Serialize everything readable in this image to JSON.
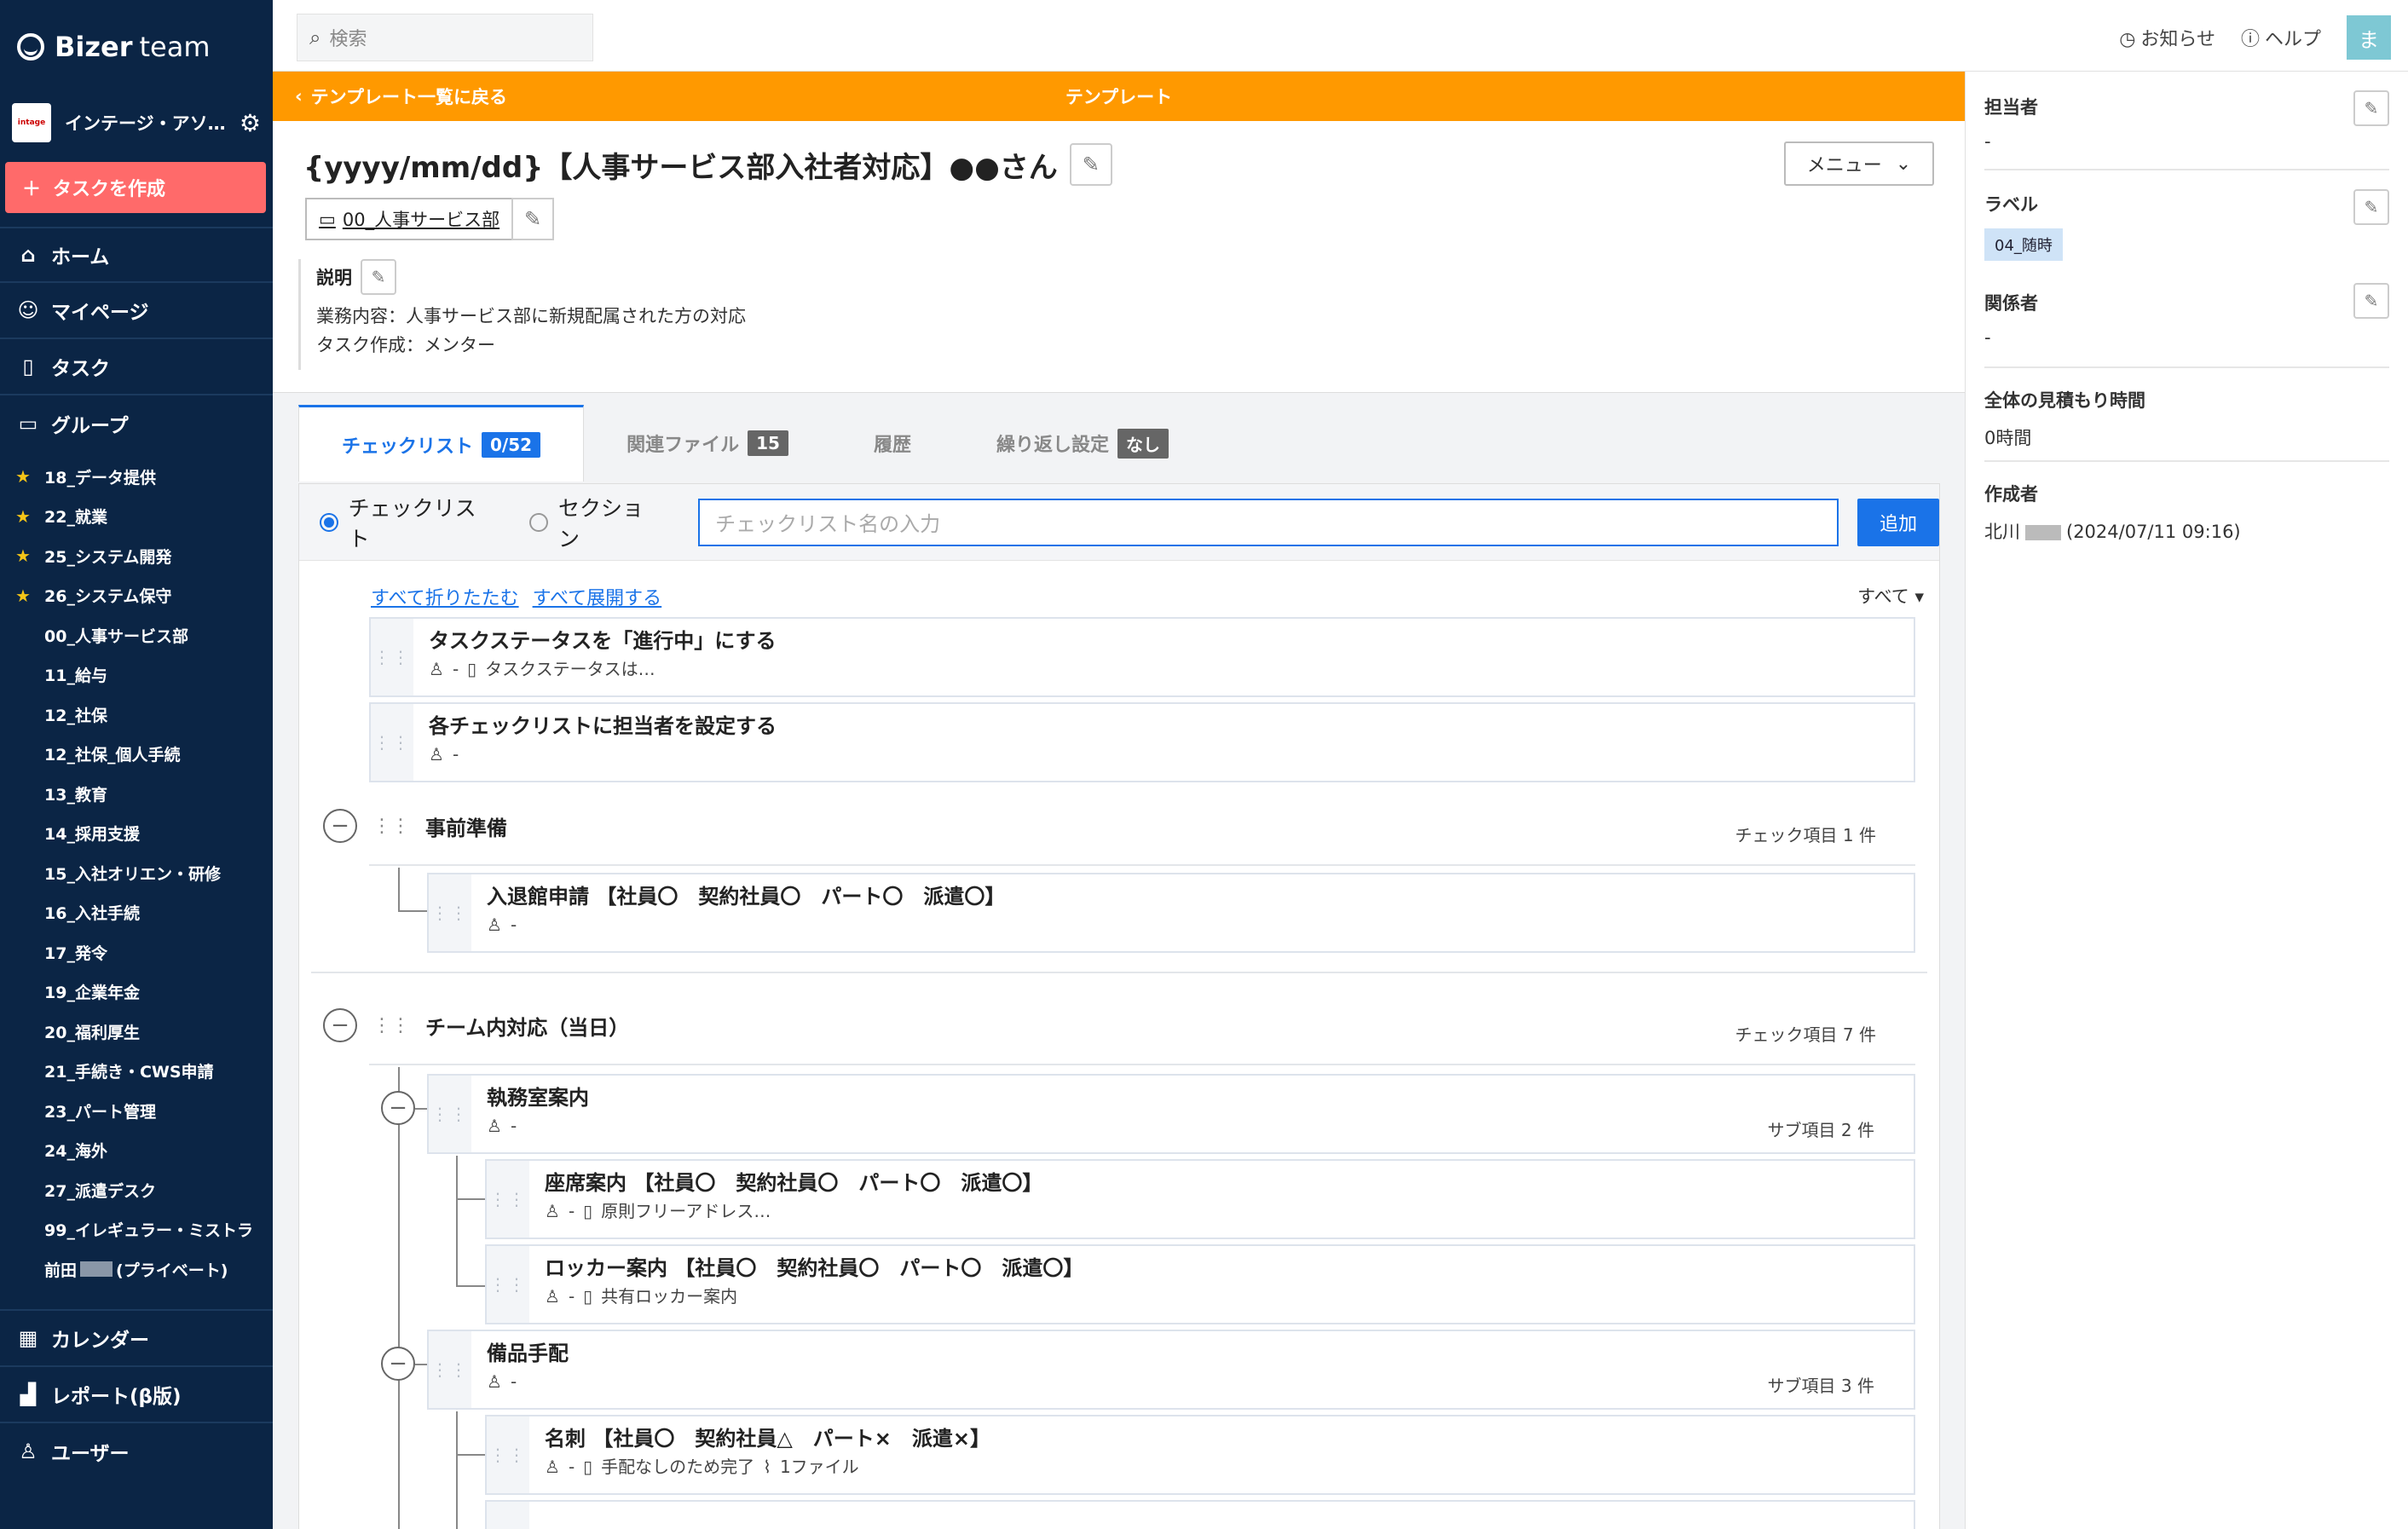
{
  "sidebar": {
    "brand": "Bizer",
    "brand_suffix": "team",
    "workspace": "インテージ・アソ…",
    "create_task": "タスクを作成",
    "nav": [
      "ホーム",
      "マイページ",
      "タスク",
      "グループ"
    ],
    "groups": [
      {
        "label": "18_データ提供",
        "star": true
      },
      {
        "label": "22_就業",
        "star": true
      },
      {
        "label": "25_システム開発",
        "star": true
      },
      {
        "label": "26_システム保守",
        "star": true
      },
      {
        "label": "00_人事サービス部",
        "star": false
      },
      {
        "label": "11_給与",
        "star": false
      },
      {
        "label": "12_社保",
        "star": false
      },
      {
        "label": "12_社保_個人手続",
        "star": false
      },
      {
        "label": "13_教育",
        "star": false
      },
      {
        "label": "14_採用支援",
        "star": false
      },
      {
        "label": "15_入社オリエン・研修",
        "star": false
      },
      {
        "label": "16_入社手続",
        "star": false
      },
      {
        "label": "17_発令",
        "star": false
      },
      {
        "label": "19_企業年金",
        "star": false
      },
      {
        "label": "20_福利厚生",
        "star": false
      },
      {
        "label": "21_手続き・CWS申請",
        "star": false
      },
      {
        "label": "23_パート管理",
        "star": false
      },
      {
        "label": "24_海外",
        "star": false
      },
      {
        "label": "27_派遣デスク",
        "star": false
      },
      {
        "label": "99_イレギュラー・ミストラ",
        "star": false
      }
    ],
    "private_group_prefix": "前田",
    "private_group_suffix": "(プライベート)",
    "bottom_nav": [
      "カレンダー",
      "レポート(β版)",
      "ユーザー"
    ]
  },
  "topbar": {
    "search_placeholder": "検索",
    "notice": "お知らせ",
    "help": "ヘルプ",
    "avatar": "ま"
  },
  "banner": {
    "back": "テンプレート一覧に戻る",
    "center": "テンプレート"
  },
  "task": {
    "title": "{yyyy/mm/dd}【人事サービス部入社者対応】●●さん",
    "menu": "メニュー",
    "folder": "00_人事サービス部",
    "desc_label": "説明",
    "desc_lines": [
      "業務内容：人事サービス部に新規配属された方の対応",
      "タスク作成：メンター"
    ]
  },
  "tabs": [
    {
      "label": "チェックリスト",
      "badge": "0/52"
    },
    {
      "label": "関連ファイル",
      "badge": "15"
    },
    {
      "label": "履歴",
      "badge": ""
    },
    {
      "label": "繰り返し設定",
      "badge": "なし"
    }
  ],
  "checklist": {
    "radio_checklist": "チェックリスト",
    "radio_section": "セクション",
    "input_placeholder": "チェックリスト名の入力",
    "add": "追加",
    "collapse_all": "すべて折りたたむ",
    "expand_all": "すべて展開する",
    "filter": "すべて",
    "items": [
      {
        "title": "タスクステータスを「進行中」にする",
        "assignee": "-",
        "note": "タスクステータスは…"
      },
      {
        "title": "各チェックリストに担当者を設定する",
        "assignee": "-",
        "note": ""
      }
    ],
    "section1": {
      "title": "事前準備",
      "count": "チェック項目 1 件"
    },
    "section1_items": [
      {
        "title": "入退館申請 【社員〇　契約社員〇　パート〇　派遣〇】",
        "assignee": "-"
      }
    ],
    "section2": {
      "title": "チーム内対応（当日）",
      "count": "チェック項目 7 件"
    },
    "section2_items": [
      {
        "title": "執務室案内",
        "assignee": "-",
        "sub": "サブ項目 2 件"
      },
      {
        "title": "座席案内 【社員〇　契約社員〇　パート〇　派遣〇】",
        "assignee": "-",
        "note": "原則フリーアドレス…"
      },
      {
        "title": "ロッカー案内 【社員〇　契約社員〇　パート〇　派遣〇】",
        "assignee": "-",
        "note": "共有ロッカー案内"
      },
      {
        "title": "備品手配",
        "assignee": "-",
        "sub": "サブ項目 3 件"
      },
      {
        "title": "名刺 【社員〇　契約社員△　パート×　派遣×】",
        "assignee": "-",
        "note": "手配なしのため完了",
        "files": "1ファイル"
      }
    ]
  },
  "right": {
    "assignee_label": "担当者",
    "assignee_value": "-",
    "label_label": "ラベル",
    "label_value": "04_随時",
    "related_label": "関係者",
    "related_value": "-",
    "estimate_label": "全体の見積もり時間",
    "estimate_value": "0時間",
    "author_label": "作成者",
    "author_prefix": "北川",
    "author_suffix": "(2024/07/11 09:16)"
  },
  "colors": {
    "sidebar": "#0b2545",
    "banner": "#ff9900",
    "accent": "#1a73e8",
    "create": "#ff6a6a"
  }
}
